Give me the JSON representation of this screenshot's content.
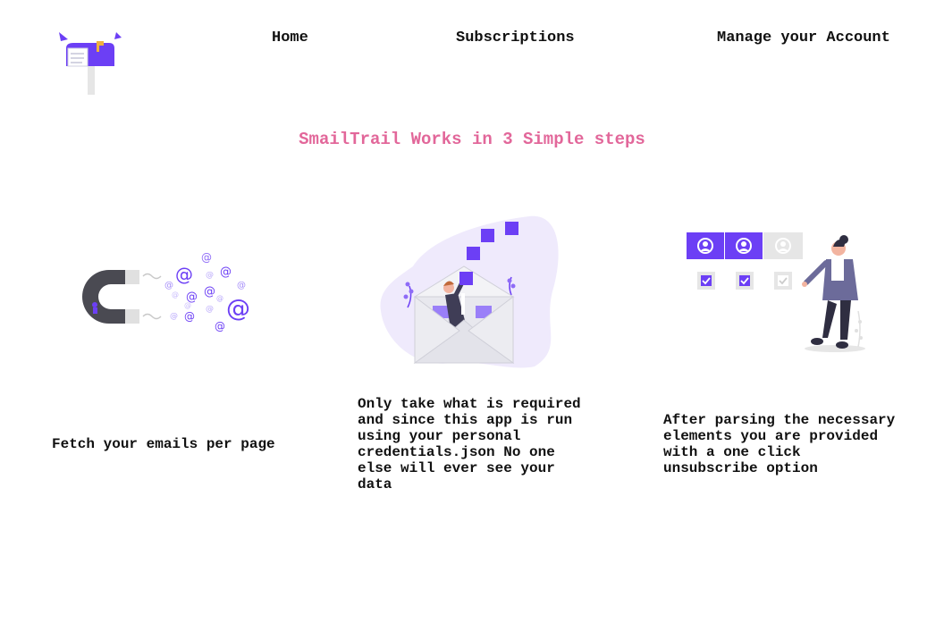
{
  "brand": {
    "logo_icon": "mailbox-logo",
    "accent": "#6c3ff5",
    "headline_color": "#e2679a"
  },
  "nav": {
    "home": "Home",
    "subscriptions": "Subscriptions",
    "account": "Manage your Account"
  },
  "main": {
    "headline": "SmailTrail Works in 3 Simple steps",
    "steps": [
      {
        "illustration": "magnet-attracting-emails-illustration",
        "text": "Fetch your emails per page"
      },
      {
        "illustration": "person-in-envelope-illustration",
        "text": "Only take what is required and since this app is run using your personal credentials.json No one else will ever see your data"
      },
      {
        "illustration": "person-checking-profiles-illustration",
        "text": "After parsing the necessary elements you are provided with a one click unsubscribe option"
      }
    ]
  }
}
